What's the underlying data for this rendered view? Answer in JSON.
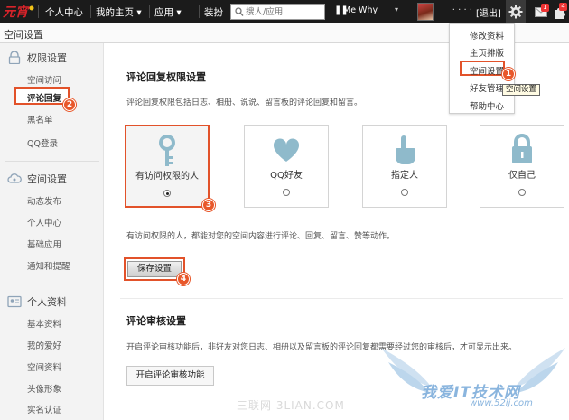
{
  "topbar": {
    "logo_text": "元宵",
    "nav": [
      "个人中心",
      "我的主页 ▾",
      "应用 ▾",
      "装扮"
    ],
    "search_placeholder": "搜人/应用",
    "music_title": "Me Why",
    "logout": "[退出]",
    "mail_badge": "1",
    "app_badge": "4"
  },
  "dropdown": {
    "items": [
      "修改资料",
      "主页排版",
      "空间设置",
      "好友管理",
      "帮助中心"
    ],
    "tooltip": "空间设置"
  },
  "page": {
    "title": "空间设置"
  },
  "sidebar": {
    "sections": [
      {
        "title": "权限设置",
        "items": [
          "空间访问",
          "评论回复",
          "黑名单",
          "QQ登录"
        ]
      },
      {
        "title": "空间设置",
        "items": [
          "动态发布",
          "个人中心",
          "基础应用",
          "通知和提醒"
        ]
      },
      {
        "title": "个人资料",
        "items": [
          "基本资料",
          "我的爱好",
          "空间资料",
          "头像形象",
          "实名认证"
        ]
      }
    ]
  },
  "main": {
    "permission_title": "评论回复权限设置",
    "permission_desc": "评论回复权限包括日志、相册、说说、留言板的评论回复和留言。",
    "options": [
      {
        "label": "有访问权限的人",
        "icon": "key-icon",
        "selected": true
      },
      {
        "label": "QQ好友",
        "icon": "heart-icon",
        "selected": false
      },
      {
        "label": "指定人",
        "icon": "hand-pointer-icon",
        "selected": false
      },
      {
        "label": "仅自己",
        "icon": "lock-icon",
        "selected": false
      }
    ],
    "option_hint": "有访问权限的人，都能对您的空间内容进行评论、回复、留言、赞等动作。",
    "save_button": "保存设置",
    "review_title": "评论审核设置",
    "review_desc": "开启评论审核功能后，非好友对您日志、相册以及留言板的评论回复都需要经过您的审核后，才可显示出来。",
    "review_button": "开启评论审核功能"
  },
  "steps": [
    "1",
    "2",
    "3",
    "4"
  ],
  "watermark": {
    "left": "三联网 3LIAN.COM",
    "right_title": "我爱IT技术网",
    "right_url": "www.52ij.com"
  },
  "colors": {
    "accent": "#e2522a",
    "topbar": "#1b1b1b",
    "icon": "#8fbacb",
    "watermark": "#8ab5de"
  }
}
